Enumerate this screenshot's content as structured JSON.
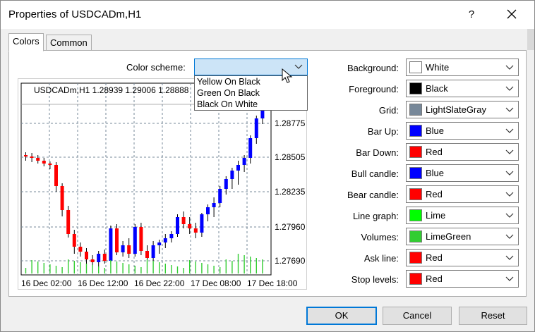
{
  "window": {
    "title": "Properties of USDCADm,H1",
    "help_glyph": "?"
  },
  "tabs": [
    {
      "label": "Colors",
      "active": true
    },
    {
      "label": "Common",
      "active": false
    }
  ],
  "color_scheme": {
    "label": "Color scheme:",
    "selected": "",
    "options": [
      "Yellow On Black",
      "Green On Black",
      "Black On White"
    ]
  },
  "chart": {
    "header": "USDCADm,H1  1.28939 1.29006 1.28888",
    "price_labels": [
      "1.28775",
      "1.28505",
      "1.28235",
      "1.27960",
      "1.27690"
    ],
    "time_labels": [
      "16 Dec 02:00",
      "16 Dec 12:00",
      "16 Dec 22:00",
      "17 Dec 08:00",
      "17 Dec 18:00"
    ],
    "colors": {
      "bull": "#0000ff",
      "bear": "#ff0000",
      "volume": "#32cd32",
      "grid": "#778899",
      "fg": "#000000"
    }
  },
  "properties": [
    {
      "label": "Background:",
      "value": "White",
      "color": "#ffffff"
    },
    {
      "label": "Foreground:",
      "value": "Black",
      "color": "#000000"
    },
    {
      "label": "Grid:",
      "value": "LightSlateGray",
      "color": "#778899"
    },
    {
      "label": "Bar Up:",
      "value": "Blue",
      "color": "#0000ff"
    },
    {
      "label": "Bar Down:",
      "value": "Red",
      "color": "#ff0000"
    },
    {
      "label": "Bull candle:",
      "value": "Blue",
      "color": "#0000ff"
    },
    {
      "label": "Bear candle:",
      "value": "Red",
      "color": "#ff0000"
    },
    {
      "label": "Line graph:",
      "value": "Lime",
      "color": "#00ff00"
    },
    {
      "label": "Volumes:",
      "value": "LimeGreen",
      "color": "#32cd32"
    },
    {
      "label": "Ask line:",
      "value": "Red",
      "color": "#ff0000"
    },
    {
      "label": "Stop levels:",
      "value": "Red",
      "color": "#ff0000"
    }
  ],
  "buttons": {
    "ok": "OK",
    "cancel": "Cancel",
    "reset": "Reset"
  }
}
